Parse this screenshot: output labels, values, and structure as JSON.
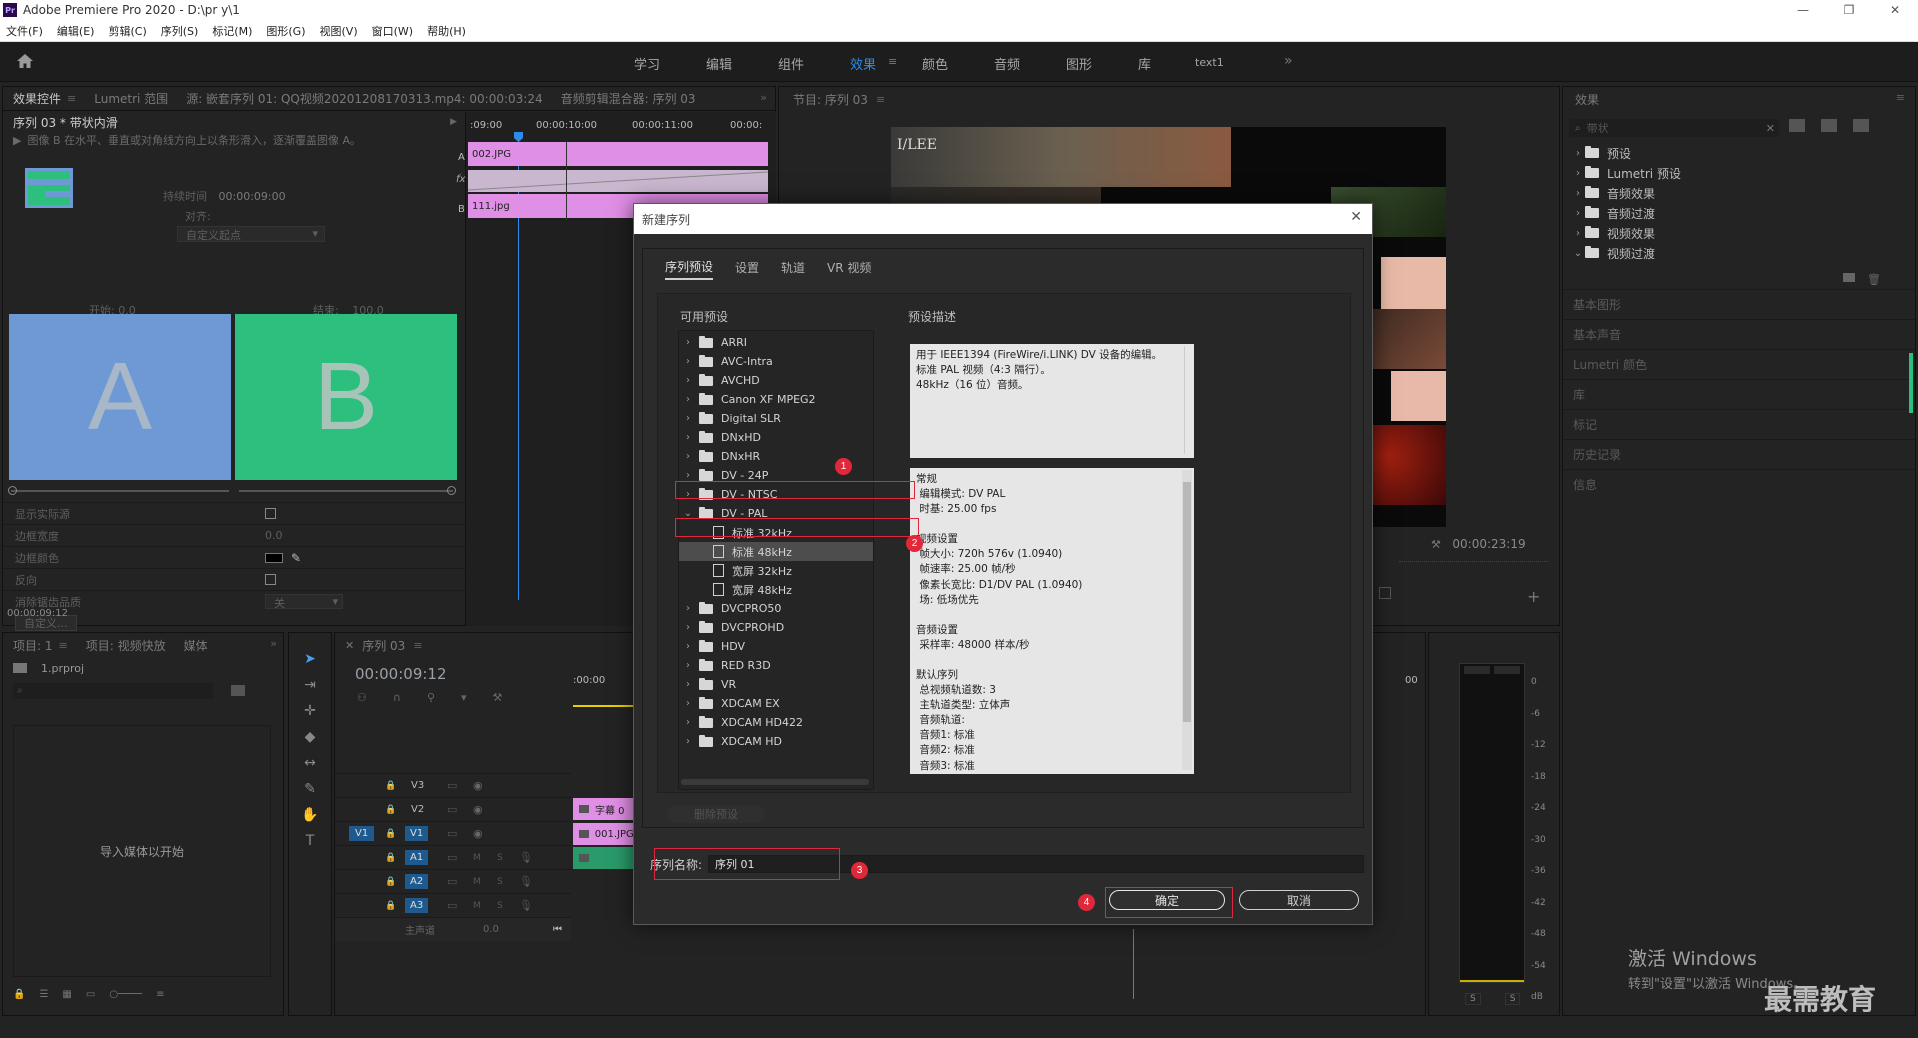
{
  "app": {
    "title": "Adobe Premiere Pro 2020 - D:\\pr y\\1",
    "logo": "Pr"
  },
  "menu": [
    "文件(F)",
    "编辑(E)",
    "剪辑(C)",
    "序列(S)",
    "标记(M)",
    "图形(G)",
    "视图(V)",
    "窗口(W)",
    "帮助(H)"
  ],
  "workspaces": [
    {
      "label": "学习"
    },
    {
      "label": "编辑"
    },
    {
      "label": "组件"
    },
    {
      "label": "效果"
    },
    {
      "label": "颜色"
    },
    {
      "label": "音频"
    },
    {
      "label": "图形"
    },
    {
      "label": "库"
    },
    {
      "label": "text1"
    }
  ],
  "effect_controls": {
    "tabs": [
      "效果控件",
      "Lumetri 范围",
      "源: 嵌套序列 01: QQ视频20201208170313.mp4: 00:00:03:24",
      "音频剪辑混合器: 序列 03"
    ],
    "clip": "序列 03 * 带状内滑",
    "description": "图像 B 在水平、垂直或对角线方向上以条形滑入，逐渐覆盖图像 A。",
    "duration_label": "持续时间",
    "duration_value": "00:00:09:00",
    "align_label": "对齐:",
    "align_value": "自定义起点",
    "start_label": "开始:",
    "start_value": "0.0",
    "end_label": "结束:",
    "end_value": "100.0",
    "preview_a": "A",
    "preview_b": "B",
    "show_source": "显示实际源",
    "border_width": "边框宽度",
    "border_width_value": "0.0",
    "border_color": "边框颜色",
    "reverse": "反向",
    "antialias": "消除锯齿品质",
    "antialias_value": "关",
    "custom_btn": "自定义...",
    "timecode": "00:00:09:12",
    "ruler": [
      ":09:00",
      "00:00:10:00",
      "00:00:11:00",
      "00:00:"
    ],
    "clip_a": "002.JPG",
    "clip_b": "111.jpg",
    "track_a": "A",
    "track_b": "B",
    "fx": "fx"
  },
  "program": {
    "tab": "节目: 序列 03",
    "timecode": "00:00:23:19",
    "overlay_text": "I/LEE"
  },
  "project": {
    "tabs": [
      "项目: 1",
      "项目: 视频快放",
      "媒体"
    ],
    "file": "1.prproj",
    "empty_text": "导入媒体以开始"
  },
  "timeline": {
    "tab": "序列 03",
    "timecode": "00:00:09:12",
    "ruler_start": ":00:00",
    "ruler_end": "00",
    "tracks_video": [
      "V3",
      "V2",
      "V1"
    ],
    "tracks_audio": [
      "A1",
      "A2",
      "A3"
    ],
    "master": "主声道",
    "master_value": "0.0",
    "source_v1": "V1",
    "clip_v2": "字幕 0",
    "clip_v1": "001.JPG"
  },
  "effects_panel": {
    "tab": "效果",
    "search_placeholder": "带状",
    "items": [
      "预设",
      "Lumetri 预设",
      "音频效果",
      "音频过渡",
      "视频效果",
      "视频过渡"
    ],
    "sections": [
      "基本图形",
      "基本声音",
      "Lumetri 颜色",
      "库",
      "标记",
      "历史记录",
      "信息"
    ]
  },
  "meter": {
    "scale": [
      "0",
      "-6",
      "-12",
      "-18",
      "-24",
      "-30",
      "-36",
      "-42",
      "-48",
      "-54",
      "dB"
    ],
    "channels": [
      "S",
      "S"
    ]
  },
  "dialog": {
    "title": "新建序列",
    "tabs": [
      "序列预设",
      "设置",
      "轨道",
      "VR 视频"
    ],
    "available_label": "可用预设",
    "desc_label": "预设描述",
    "presets": [
      {
        "label": "ARRI",
        "kind": "folder",
        "open": false
      },
      {
        "label": "AVC-Intra",
        "kind": "folder",
        "open": false
      },
      {
        "label": "AVCHD",
        "kind": "folder",
        "open": false
      },
      {
        "label": "Canon XF MPEG2",
        "kind": "folder",
        "open": false
      },
      {
        "label": "Digital SLR",
        "kind": "folder",
        "open": false
      },
      {
        "label": "DNxHD",
        "kind": "folder",
        "open": false
      },
      {
        "label": "DNxHR",
        "kind": "folder",
        "open": false
      },
      {
        "label": "DV - 24P",
        "kind": "folder",
        "open": false
      },
      {
        "label": "DV - NTSC",
        "kind": "folder",
        "open": false
      },
      {
        "label": "DV - PAL",
        "kind": "folder",
        "open": true
      },
      {
        "label": "标准 32kHz",
        "kind": "file",
        "child": true
      },
      {
        "label": "标准 48kHz",
        "kind": "file",
        "child": true,
        "selected": true
      },
      {
        "label": "宽屏 32kHz",
        "kind": "file",
        "child": true
      },
      {
        "label": "宽屏 48kHz",
        "kind": "file",
        "child": true
      },
      {
        "label": "DVCPRO50",
        "kind": "folder",
        "open": false
      },
      {
        "label": "DVCPROHD",
        "kind": "folder",
        "open": false
      },
      {
        "label": "HDV",
        "kind": "folder",
        "open": false
      },
      {
        "label": "RED R3D",
        "kind": "folder",
        "open": false
      },
      {
        "label": "VR",
        "kind": "folder",
        "open": false
      },
      {
        "label": "XDCAM EX",
        "kind": "folder",
        "open": false
      },
      {
        "label": "XDCAM HD422",
        "kind": "folder",
        "open": false
      },
      {
        "label": "XDCAM HD",
        "kind": "folder",
        "open": false
      }
    ],
    "description_lines": [
      "用于 IEEE1394 (FireWire/i.LINK) DV 设备的编辑。",
      "标准 PAL 视频（4:3 隔行）。",
      "48kHz（16 位）音频。"
    ],
    "details_lines": [
      "常规",
      " 编辑模式: DV PAL",
      " 时基: 25.00 fps",
      "",
      "视频设置",
      " 帧大小: 720h 576v (1.0940)",
      " 帧速率: 25.00 帧/秒",
      " 像素长宽比: D1/DV PAL (1.0940)",
      " 场: 低场优先",
      "",
      "音频设置",
      " 采样率: 48000 样本/秒",
      "",
      "默认序列",
      " 总视频轨道数: 3",
      " 主轨道类型: 立体声",
      " 音频轨道:",
      " 音频1: 标准",
      " 音频2: 标准",
      " 音频3: 标准"
    ],
    "delete_preset": "删除预设",
    "seq_name_label": "序列名称:",
    "seq_name_value": "序列 01",
    "ok": "确定",
    "cancel": "取消",
    "badges": [
      "1",
      "2",
      "3",
      "4"
    ]
  },
  "watermark": {
    "line1": "激活 Windows",
    "line2": "转到\"设置\"以激活 Windows。",
    "logo": "最需教育"
  },
  "colors": {
    "accent_blue": "#2d8ceb",
    "clip_pink": "#e08fe6",
    "preview_a": "#6e99d4",
    "preview_b": "#2dbf7e",
    "annotation_red": "#e0283a"
  }
}
